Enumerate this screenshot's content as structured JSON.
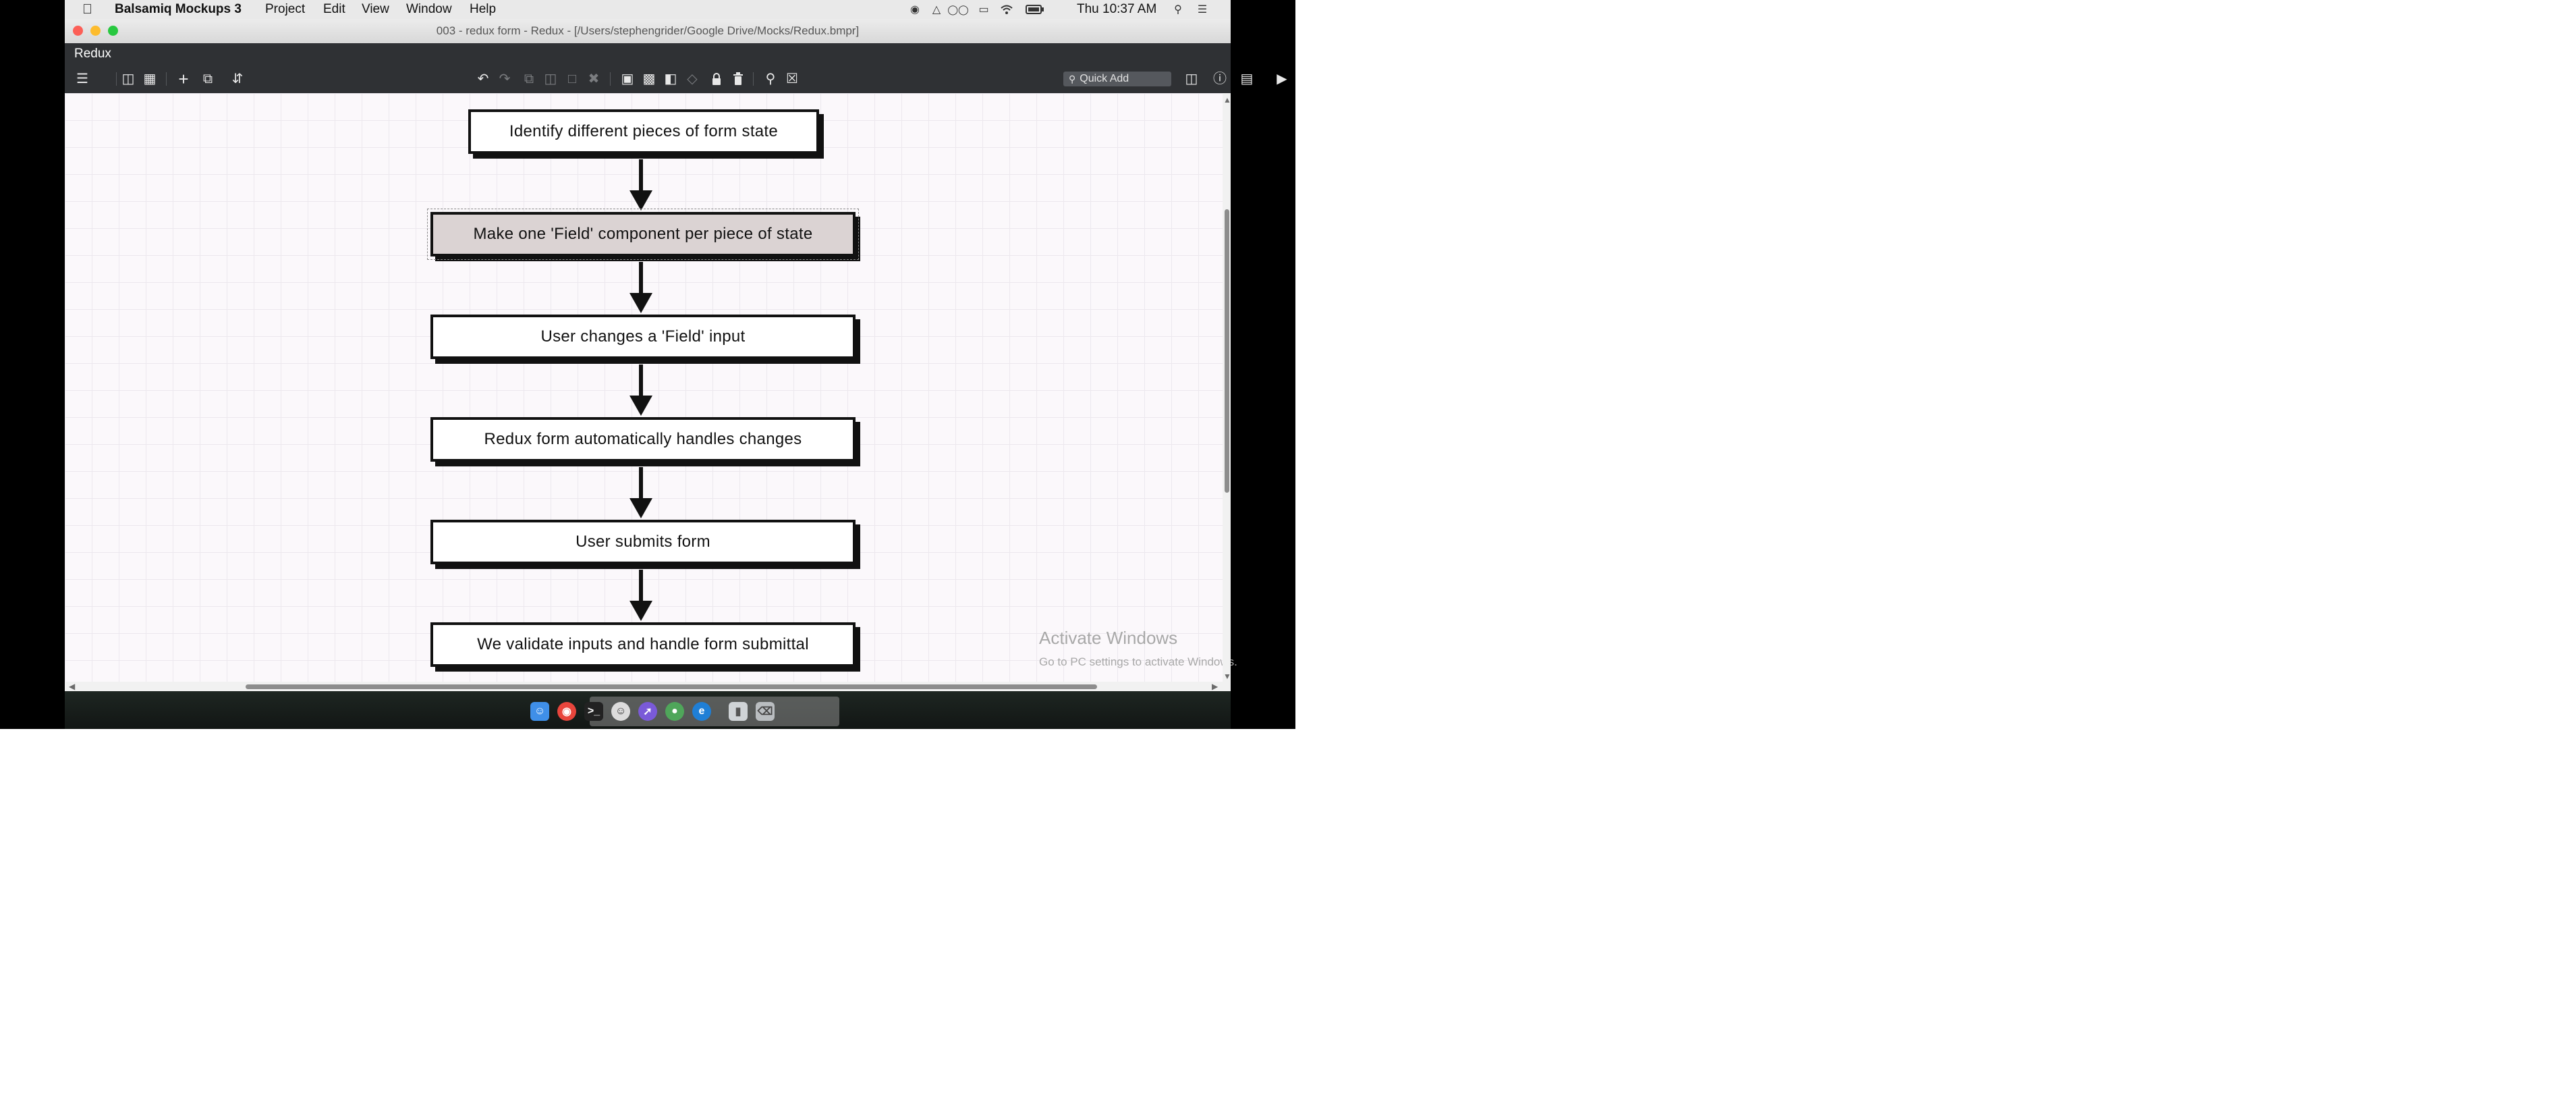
{
  "menubar": {
    "app_name": "Balsamiq Mockups 3",
    "items": [
      "Project",
      "Edit",
      "View",
      "Window",
      "Help"
    ],
    "clock": "Thu 10:37 AM"
  },
  "window": {
    "title": "003 - redux form - Redux - [/Users/stephengrider/Google Drive/Mocks/Redux.bmpr]"
  },
  "tab": {
    "name": "Redux"
  },
  "toolbar": {
    "quick_add_label": "Quick Add"
  },
  "flowchart": {
    "nodes": [
      {
        "label": "Identify different pieces of form state",
        "selected": false
      },
      {
        "label": "Make one 'Field' component per piece of state",
        "selected": true
      },
      {
        "label": "User changes a 'Field' input",
        "selected": false
      },
      {
        "label": "Redux form automatically handles changes",
        "selected": false
      },
      {
        "label": "User submits form",
        "selected": false
      },
      {
        "label": "We validate inputs and handle form submittal",
        "selected": false
      }
    ]
  },
  "watermark": {
    "title": "Activate Windows",
    "subtitle": "Go to PC settings to activate Windows."
  },
  "colors": {
    "toolbar_bg": "#2f3134",
    "canvas_bg": "#fbf8fb",
    "selected_fill": "#dbd3d3",
    "close": "#fc5f57",
    "minimize": "#fdbc2e",
    "zoom": "#28c840"
  },
  "icons": {
    "menubar": [
      "apple-icon"
    ],
    "tray": [
      "record-icon",
      "drive-icon",
      "glasses-icon",
      "airplay-icon",
      "wifi-icon",
      "battery-icon",
      "search-icon",
      "list-icon"
    ],
    "toolbar_left": [
      "menu-icon",
      "panel-icon",
      "grid-icon",
      "add-icon",
      "clone-icon",
      "arrange-icon"
    ],
    "toolbar_middle": [
      "undo-icon",
      "redo-icon",
      "copy-icon",
      "paste-icon",
      "duplicate-icon",
      "delete-icon",
      "group-icon",
      "ungroup-icon",
      "bring-front-icon",
      "send-back-icon",
      "lock-icon",
      "trash-icon",
      "zoom-icon",
      "fit-icon"
    ],
    "toolbar_right": [
      "search-icon",
      "markup-icon",
      "info-icon",
      "notes-icon",
      "present-icon"
    ],
    "dock": [
      "finder-icon",
      "chrome-icon",
      "terminal-icon",
      "messages-icon",
      "safari-icon",
      "maps-icon",
      "edge-icon",
      "stack-icon",
      "trash-icon"
    ]
  }
}
